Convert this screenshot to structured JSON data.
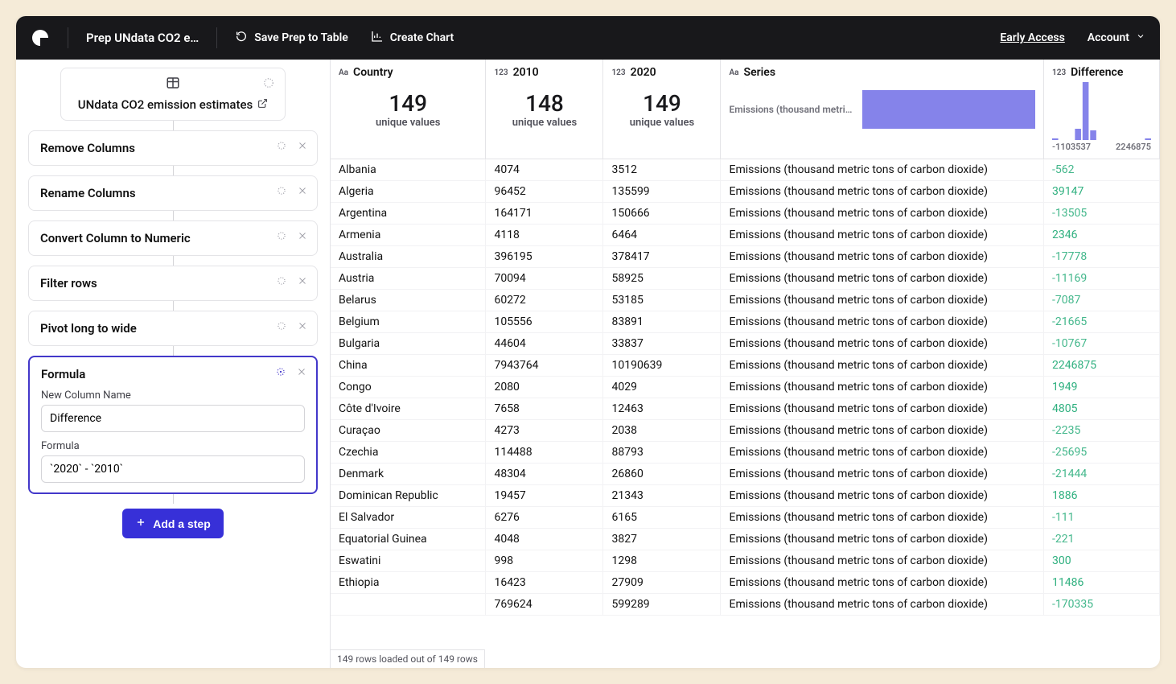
{
  "topbar": {
    "title": "Prep UNdata CO2 e…",
    "save_label": "Save Prep to Table",
    "create_chart_label": "Create Chart",
    "early_access": "Early Access",
    "account": "Account"
  },
  "source": {
    "label": "UNdata CO2 emission estimates"
  },
  "steps": [
    {
      "title": "Remove Columns"
    },
    {
      "title": "Rename Columns"
    },
    {
      "title": "Convert Column to Numeric"
    },
    {
      "title": "Filter rows"
    },
    {
      "title": "Pivot long to wide"
    }
  ],
  "formula_step": {
    "title": "Formula",
    "new_col_label": "New Column Name",
    "new_col_value": "Difference",
    "formula_label": "Formula",
    "formula_value": "`2020` - `2010`"
  },
  "add_step_label": "Add a step",
  "columns": [
    {
      "name": "Country",
      "type": "Aa",
      "stat_n": "149",
      "stat_l": "unique values"
    },
    {
      "name": "2010",
      "type": "123",
      "stat_n": "148",
      "stat_l": "unique values"
    },
    {
      "name": "2020",
      "type": "123",
      "stat_n": "149",
      "stat_l": "unique values"
    },
    {
      "name": "Series",
      "type": "Aa"
    },
    {
      "name": "Difference",
      "type": "123",
      "hist_min": "-1103537",
      "hist_max": "2246875"
    }
  ],
  "series_preview_text": "Emissions (thousand metri…",
  "rows": [
    {
      "country": "Albania",
      "y2010": "4074",
      "y2020": "3512",
      "series": "Emissions (thousand metric tons of carbon dioxide)",
      "diff": "-562"
    },
    {
      "country": "Algeria",
      "y2010": "96452",
      "y2020": "135599",
      "series": "Emissions (thousand metric tons of carbon dioxide)",
      "diff": "39147"
    },
    {
      "country": "Argentina",
      "y2010": "164171",
      "y2020": "150666",
      "series": "Emissions (thousand metric tons of carbon dioxide)",
      "diff": "-13505"
    },
    {
      "country": "Armenia",
      "y2010": "4118",
      "y2020": "6464",
      "series": "Emissions (thousand metric tons of carbon dioxide)",
      "diff": "2346"
    },
    {
      "country": "Australia",
      "y2010": "396195",
      "y2020": "378417",
      "series": "Emissions (thousand metric tons of carbon dioxide)",
      "diff": "-17778"
    },
    {
      "country": "Austria",
      "y2010": "70094",
      "y2020": "58925",
      "series": "Emissions (thousand metric tons of carbon dioxide)",
      "diff": "-11169"
    },
    {
      "country": "Belarus",
      "y2010": "60272",
      "y2020": "53185",
      "series": "Emissions (thousand metric tons of carbon dioxide)",
      "diff": "-7087"
    },
    {
      "country": "Belgium",
      "y2010": "105556",
      "y2020": "83891",
      "series": "Emissions (thousand metric tons of carbon dioxide)",
      "diff": "-21665"
    },
    {
      "country": "Bulgaria",
      "y2010": "44604",
      "y2020": "33837",
      "series": "Emissions (thousand metric tons of carbon dioxide)",
      "diff": "-10767"
    },
    {
      "country": "China",
      "y2010": "7943764",
      "y2020": "10190639",
      "series": "Emissions (thousand metric tons of carbon dioxide)",
      "diff": "2246875"
    },
    {
      "country": "Congo",
      "y2010": "2080",
      "y2020": "4029",
      "series": "Emissions (thousand metric tons of carbon dioxide)",
      "diff": "1949"
    },
    {
      "country": "Côte d'Ivoire",
      "y2010": "7658",
      "y2020": "12463",
      "series": "Emissions (thousand metric tons of carbon dioxide)",
      "diff": "4805"
    },
    {
      "country": "Curaçao",
      "y2010": "4273",
      "y2020": "2038",
      "series": "Emissions (thousand metric tons of carbon dioxide)",
      "diff": "-2235"
    },
    {
      "country": "Czechia",
      "y2010": "114488",
      "y2020": "88793",
      "series": "Emissions (thousand metric tons of carbon dioxide)",
      "diff": "-25695"
    },
    {
      "country": "Denmark",
      "y2010": "48304",
      "y2020": "26860",
      "series": "Emissions (thousand metric tons of carbon dioxide)",
      "diff": "-21444"
    },
    {
      "country": "Dominican Republic",
      "y2010": "19457",
      "y2020": "21343",
      "series": "Emissions (thousand metric tons of carbon dioxide)",
      "diff": "1886"
    },
    {
      "country": "El Salvador",
      "y2010": "6276",
      "y2020": "6165",
      "series": "Emissions (thousand metric tons of carbon dioxide)",
      "diff": "-111"
    },
    {
      "country": "Equatorial Guinea",
      "y2010": "4048",
      "y2020": "3827",
      "series": "Emissions (thousand metric tons of carbon dioxide)",
      "diff": "-221"
    },
    {
      "country": "Eswatini",
      "y2010": "998",
      "y2020": "1298",
      "series": "Emissions (thousand metric tons of carbon dioxide)",
      "diff": "300"
    },
    {
      "country": "Ethiopia",
      "y2010": "16423",
      "y2020": "27909",
      "series": "Emissions (thousand metric tons of carbon dioxide)",
      "diff": "11486"
    },
    {
      "country": "",
      "y2010": "769624",
      "y2020": "599289",
      "series": "Emissions (thousand metric tons of carbon dioxide)",
      "diff": "-170335"
    }
  ],
  "footer_status": "149 rows loaded out of 149 rows"
}
